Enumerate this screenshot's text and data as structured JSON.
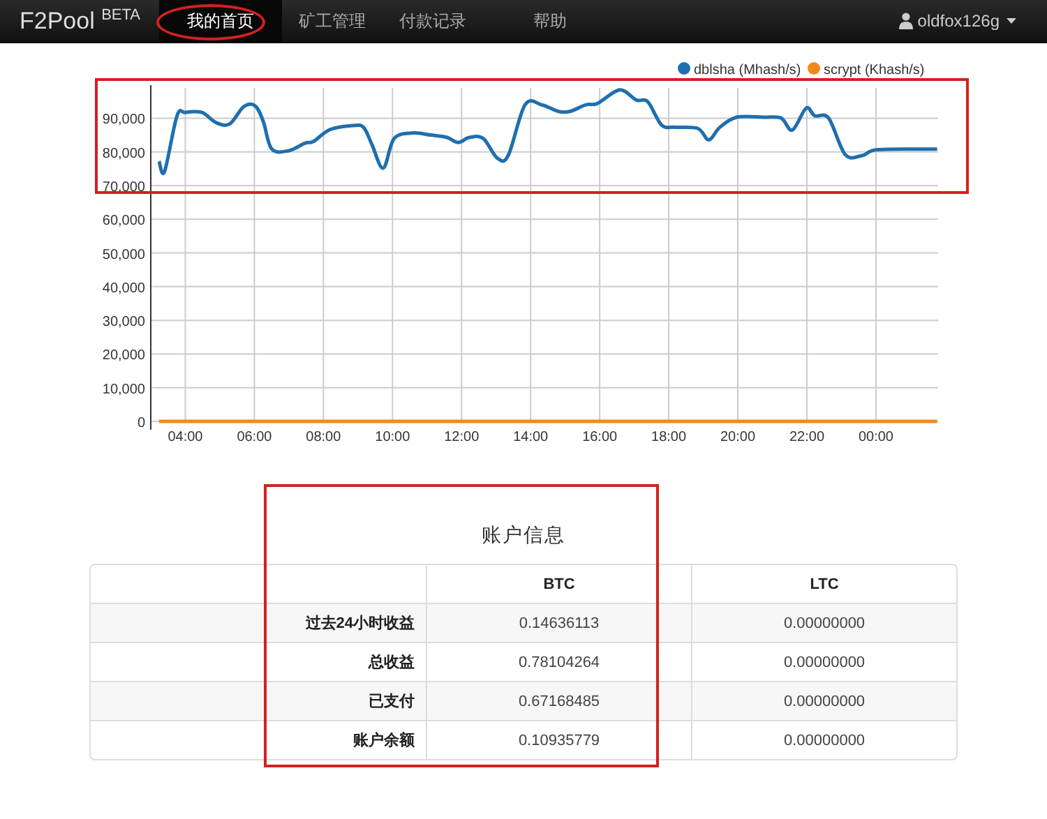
{
  "navbar": {
    "brand": "F2Pool $^{BETA}$",
    "items": [
      {
        "label": "我的首页",
        "selected": true
      },
      {
        "label": "矿工管理",
        "selected": false
      },
      {
        "label": "付款记录",
        "selected": false
      },
      {
        "label": "帮助",
        "selected": false
      }
    ],
    "user": "oldfox126g"
  },
  "chart": {
    "chart_data": {
      "type": "line",
      "x": [
        3.24,
        3.4,
        3.76,
        4.0,
        4.48,
        4.89,
        5.29,
        5.69,
        6.02,
        6.26,
        6.5,
        6.98,
        7.47,
        7.71,
        8.19,
        8.84,
        9.16,
        9.4,
        9.73,
        10.05,
        10.61,
        11.1,
        11.58,
        11.9,
        12.23,
        12.63,
        13.03,
        13.35,
        13.84,
        14.32,
        14.81,
        15.13,
        15.61,
        15.94,
        16.58,
        17.06,
        17.39,
        17.79,
        18.19,
        18.84,
        19.16,
        19.48,
        19.97,
        20.77,
        21.26,
        21.58,
        21.98,
        22.23,
        22.63,
        23.11,
        23.6,
        24.0,
        25.21,
        25.77
      ],
      "series": [
        {
          "name": "dblsha (Mhash/s)",
          "color": "#1f6fae",
          "values": [
            77200,
            74200,
            90700,
            91700,
            91700,
            88700,
            88300,
            93400,
            93700,
            89000,
            80900,
            80300,
            82600,
            83100,
            86600,
            87800,
            87300,
            82300,
            75200,
            84000,
            85600,
            85000,
            84300,
            82800,
            84300,
            84000,
            78200,
            78900,
            94000,
            94000,
            92000,
            92000,
            94000,
            94400,
            98400,
            95400,
            94900,
            88000,
            87300,
            87000,
            83600,
            87300,
            90300,
            90300,
            90000,
            86500,
            93000,
            90700,
            90000,
            79200,
            78900,
            80600,
            80800,
            80800
          ]
        },
        {
          "name": "scrypt (Khash/s)",
          "color": "#f28a1b",
          "values": [
            0,
            0,
            0,
            0,
            0,
            0,
            0,
            0,
            0,
            0,
            0,
            0,
            0,
            0,
            0,
            0,
            0,
            0,
            0,
            0,
            0,
            0,
            0,
            0,
            0,
            0,
            0,
            0,
            0,
            0,
            0,
            0,
            0,
            0,
            0,
            0,
            0,
            0,
            0,
            0,
            0,
            0,
            0,
            0,
            0,
            0,
            0,
            0,
            0,
            0,
            0,
            0,
            0,
            0
          ]
        }
      ],
      "grid": true,
      "legend": true,
      "xlim": [
        3,
        25.8
      ],
      "ylim": [
        0,
        99000
      ],
      "xticks": [
        {
          "value": 4,
          "label": "04:00"
        },
        {
          "value": 6,
          "label": "06:00"
        },
        {
          "value": 8,
          "label": "08:00"
        },
        {
          "value": 10,
          "label": "10:00"
        },
        {
          "value": 12,
          "label": "12:00"
        },
        {
          "value": 14,
          "label": "14:00"
        },
        {
          "value": 16,
          "label": "16:00"
        },
        {
          "value": 18,
          "label": "18:00"
        },
        {
          "value": 20,
          "label": "20:00"
        },
        {
          "value": 22,
          "label": "22:00"
        },
        {
          "value": 24,
          "label": "00:00"
        }
      ],
      "yticks": [
        {
          "value": 0,
          "label": "0"
        },
        {
          "value": 10000,
          "label": "10,000"
        },
        {
          "value": 20000,
          "label": "20,000"
        },
        {
          "value": 30000,
          "label": "30,000"
        },
        {
          "value": 40000,
          "label": "40,000"
        },
        {
          "value": 50000,
          "label": "50,000"
        },
        {
          "value": 60000,
          "label": "60,000"
        },
        {
          "value": 70000,
          "label": "70,000"
        },
        {
          "value": 80000,
          "label": "80,000"
        },
        {
          "value": 90000,
          "label": "90,000"
        }
      ]
    }
  },
  "account": {
    "title": "账户信息",
    "columns": [
      "BTC",
      "LTC"
    ],
    "rows": [
      {
        "label": "过去24小时收益",
        "values": [
          "0.14636113",
          "0.00000000"
        ]
      },
      {
        "label": "总收益",
        "values": [
          "0.78104264",
          "0.00000000"
        ]
      },
      {
        "label": "已支付",
        "values": [
          "0.67168485",
          "0.00000000"
        ]
      },
      {
        "label": "账户余额",
        "values": [
          "0.10935779",
          "0.00000000"
        ]
      }
    ]
  }
}
